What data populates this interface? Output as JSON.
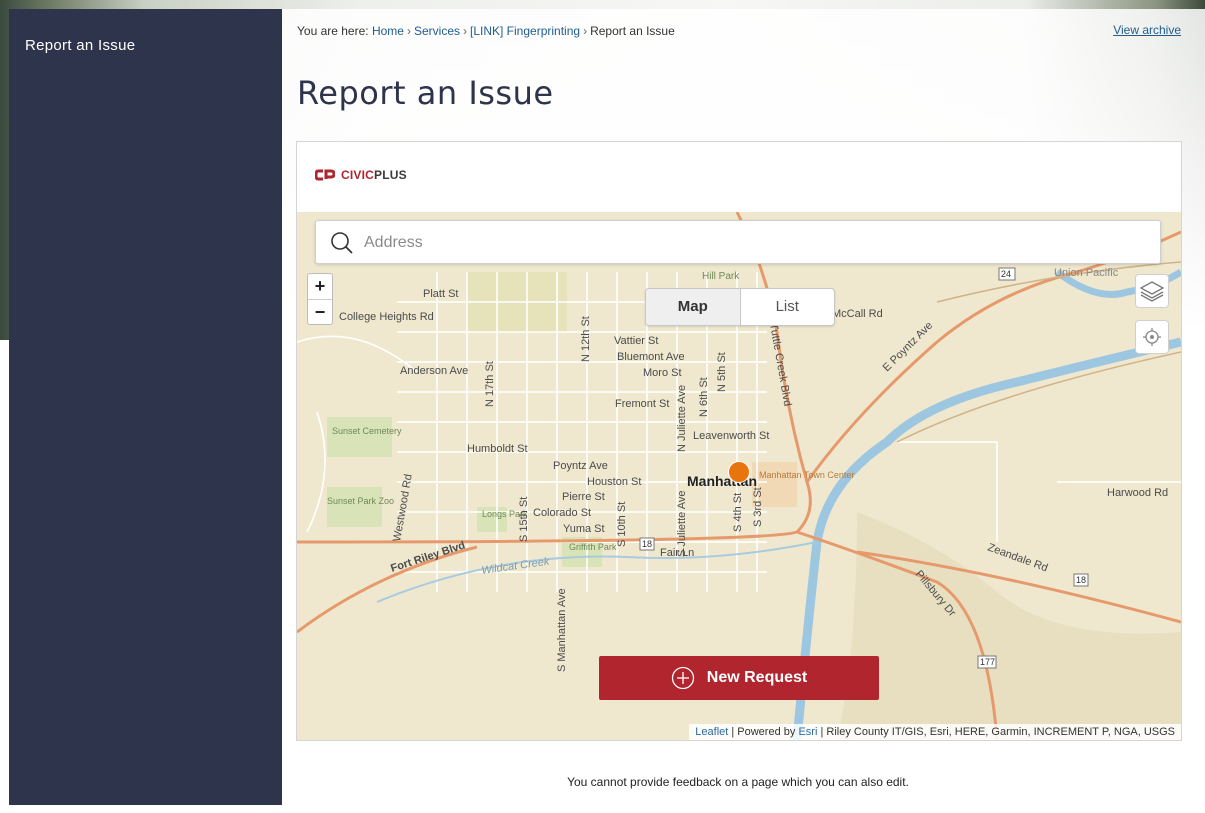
{
  "sidebar": {
    "items": [
      {
        "label": "Report an Issue"
      }
    ]
  },
  "breadcrumb": {
    "prefix": "You are here:",
    "links": [
      "Home",
      "Services",
      "[LINK] Fingerprinting"
    ],
    "current": "Report an Issue"
  },
  "header": {
    "view_archive": "View archive",
    "title": "Report an Issue"
  },
  "widget": {
    "logo": {
      "brand_a": "CIVIC",
      "brand_b": "PLUS"
    },
    "search": {
      "placeholder": "Address"
    },
    "zoom": {
      "in": "+",
      "out": "−"
    },
    "toggle": {
      "map": "Map",
      "list": "List",
      "selected": "Map"
    },
    "new_request": "New Request",
    "attribution": {
      "leaflet": "Leaflet",
      "powered": "| Powered by",
      "esri": "Esri",
      "rest": "| Riley County IT/GIS, Esri, HERE, Garmin, INCREMENT P, NGA, USGS"
    },
    "map_labels": [
      "Platt St",
      "College Heights Rd",
      "Anderson Ave",
      "Bluemont Ave",
      "Moro St",
      "Vattier St",
      "Fremont St",
      "Leavenworth St",
      "Humboldt St",
      "Poyntz Ave",
      "Houston St",
      "Pierre St",
      "Colorado St",
      "Yuma St",
      "Fair Ln",
      "Fort Riley Blvd",
      "Wildcat Creek",
      "Manhattan",
      "Manhattan Town Center",
      "Harwood Rd",
      "Zeandale Rd",
      "Pillsbury Dr",
      "E Poyntz Ave",
      "McCall Rd",
      "Union Pacific",
      "Hill Park",
      "Sunset Cemetery",
      "Sunset Park Zoo",
      "Longs Park",
      "Griffith Park",
      "Westwood Rd",
      "S Manhattan Ave",
      "N 17th St",
      "N 12th St",
      "S 15th St",
      "S 10th St",
      "S Juliette Ave",
      "N Juliette Ave",
      "N 6th St",
      "N 5th St",
      "S 4th St",
      "S 3rd St",
      "Tuttle Creek Blvd",
      "18",
      "24",
      "177"
    ]
  },
  "footer": {
    "note": "You cannot provide feedback on a page which you can also edit."
  },
  "colors": {
    "sidebar": "#2d344b",
    "accent": "#b0252e",
    "link": "#1f5c8f",
    "pin": "#e8740e"
  }
}
